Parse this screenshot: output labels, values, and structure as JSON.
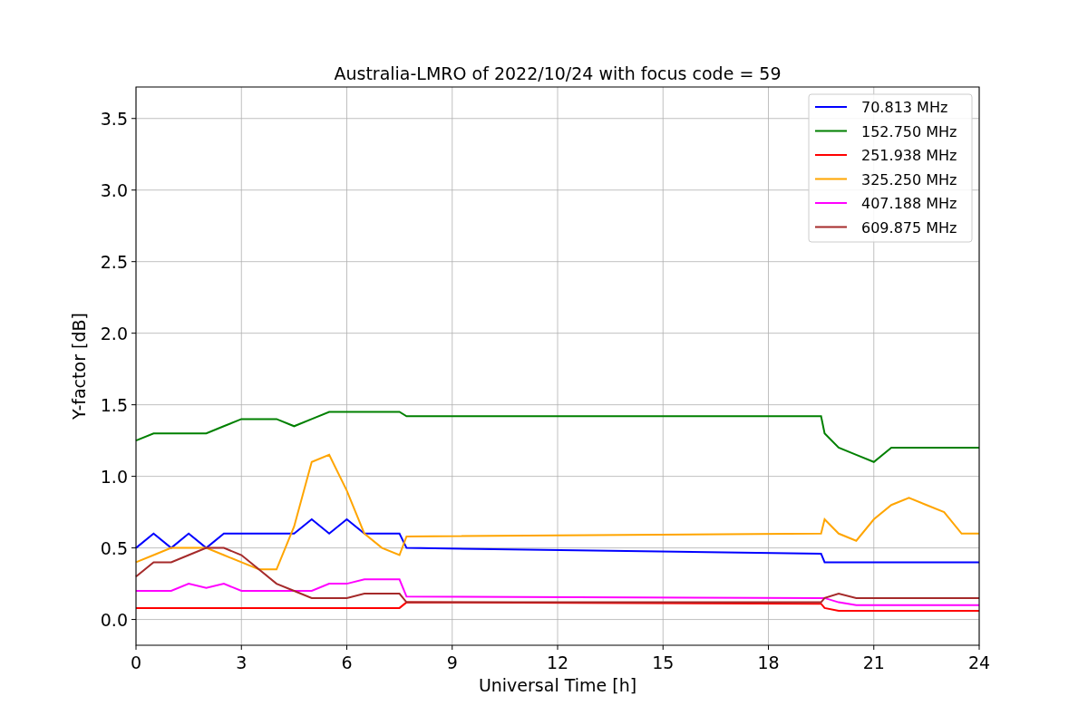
{
  "figure": {
    "chart_data": {
      "type": "line",
      "title": "Australia-LMRO of 2022/10/24 with focus code = 59",
      "xlabel": "Universal Time [h]",
      "ylabel": "Y-factor [dB]",
      "x": [
        0,
        0.5,
        1,
        1.5,
        2,
        2.5,
        3,
        3.5,
        4,
        4.5,
        5,
        5.5,
        6,
        6.5,
        7,
        7.5,
        7.7,
        19.5,
        19.6,
        20,
        20.5,
        21,
        21.5,
        22,
        22.5,
        23,
        23.5,
        24
      ],
      "series": [
        {
          "name": "70.813 MHz",
          "color": "#0000ff",
          "values": [
            0.5,
            0.6,
            0.5,
            0.6,
            0.5,
            0.6,
            0.6,
            0.6,
            0.6,
            0.6,
            0.7,
            0.6,
            0.7,
            0.6,
            0.6,
            0.6,
            0.5,
            0.46,
            0.4,
            0.4,
            0.4,
            0.4,
            0.4,
            0.4,
            0.4,
            0.4,
            0.4,
            0.4
          ]
        },
        {
          "name": "152.750 MHz",
          "color": "#008000",
          "values": [
            1.25,
            1.3,
            1.3,
            1.3,
            1.3,
            1.35,
            1.4,
            1.4,
            1.4,
            1.35,
            1.4,
            1.45,
            1.45,
            1.45,
            1.45,
            1.45,
            1.42,
            1.42,
            1.3,
            1.2,
            1.15,
            1.1,
            1.2,
            1.2,
            1.2,
            1.2,
            1.2,
            1.2
          ]
        },
        {
          "name": "251.938 MHz",
          "color": "#ff0000",
          "values": [
            0.08,
            0.08,
            0.08,
            0.08,
            0.08,
            0.08,
            0.08,
            0.08,
            0.08,
            0.08,
            0.08,
            0.08,
            0.08,
            0.08,
            0.08,
            0.08,
            0.12,
            0.11,
            0.08,
            0.06,
            0.06,
            0.06,
            0.06,
            0.06,
            0.06,
            0.06,
            0.06,
            0.06
          ]
        },
        {
          "name": "325.250 MHz",
          "color": "#ffa500",
          "values": [
            0.4,
            0.45,
            0.5,
            0.5,
            0.5,
            0.45,
            0.4,
            0.35,
            0.35,
            0.65,
            1.1,
            1.15,
            0.9,
            0.6,
            0.5,
            0.45,
            0.58,
            0.6,
            0.7,
            0.6,
            0.55,
            0.7,
            0.8,
            0.85,
            0.8,
            0.75,
            0.6,
            0.6
          ]
        },
        {
          "name": "407.188 MHz",
          "color": "#ff00ff",
          "values": [
            0.2,
            0.2,
            0.2,
            0.25,
            0.22,
            0.25,
            0.2,
            0.2,
            0.2,
            0.2,
            0.2,
            0.25,
            0.25,
            0.28,
            0.28,
            0.28,
            0.16,
            0.15,
            0.15,
            0.12,
            0.1,
            0.1,
            0.1,
            0.1,
            0.1,
            0.1,
            0.1,
            0.1
          ]
        },
        {
          "name": "609.875 MHz",
          "color": "#a52a2a",
          "values": [
            0.3,
            0.4,
            0.4,
            0.45,
            0.5,
            0.5,
            0.45,
            0.35,
            0.25,
            0.2,
            0.15,
            0.15,
            0.15,
            0.18,
            0.18,
            0.18,
            0.12,
            0.12,
            0.15,
            0.18,
            0.15,
            0.15,
            0.15,
            0.15,
            0.15,
            0.15,
            0.15,
            0.15
          ]
        }
      ],
      "grid": true,
      "legend": true,
      "xlim": [
        0,
        24
      ],
      "ylim": [
        -0.18,
        3.72
      ],
      "xticks": [
        0,
        3,
        6,
        9,
        12,
        15,
        18,
        21,
        24
      ],
      "yticks": [
        {
          "value": 0,
          "label": "0.0"
        },
        {
          "value": 0.5,
          "label": "0.5"
        },
        {
          "value": 1,
          "label": "1.0"
        },
        {
          "value": 1.5,
          "label": "1.5"
        },
        {
          "value": 2,
          "label": "2.0"
        },
        {
          "value": 2.5,
          "label": "2.5"
        },
        {
          "value": 3,
          "label": "3.0"
        },
        {
          "value": 3.5,
          "label": "3.5"
        }
      ]
    }
  }
}
